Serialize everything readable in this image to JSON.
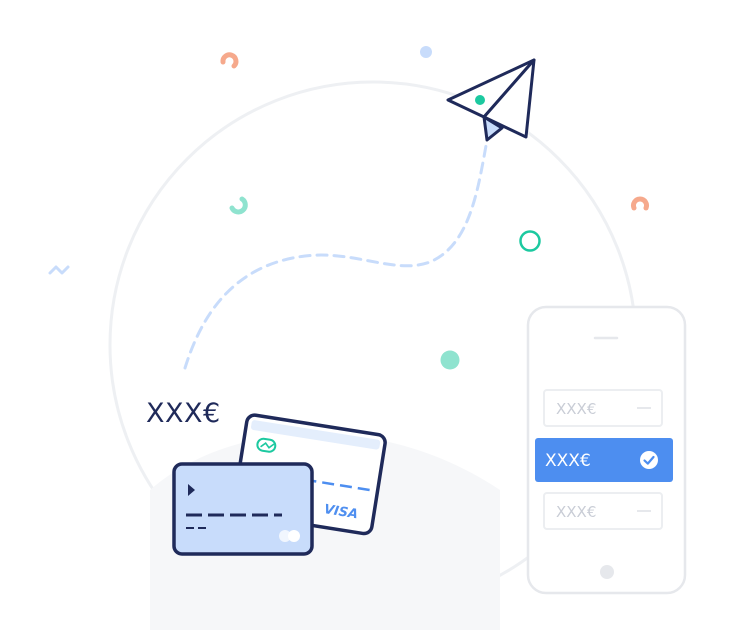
{
  "illustration": {
    "amount_label": "XXX€",
    "card_brand": "VISA",
    "options": [
      {
        "label": "XXX€",
        "selected": false
      },
      {
        "label": "XXX€",
        "selected": true
      },
      {
        "label": "XXX€",
        "selected": false
      }
    ]
  },
  "colors": {
    "navy": "#1f2a5a",
    "accent_blue": "#4d8ef0",
    "light_blue": "#c8dcfb",
    "mint": "#8fe3cf",
    "teal": "#1cc9a0",
    "salmon": "#f6a98c",
    "circle_stroke": "#eef0f3",
    "phone_stroke": "#e6e8ec"
  },
  "icons": [
    "paper-plane-icon",
    "check-circle-icon",
    "contactless-icon",
    "chip-arrow-icon",
    "card-brand-logo-icon"
  ]
}
